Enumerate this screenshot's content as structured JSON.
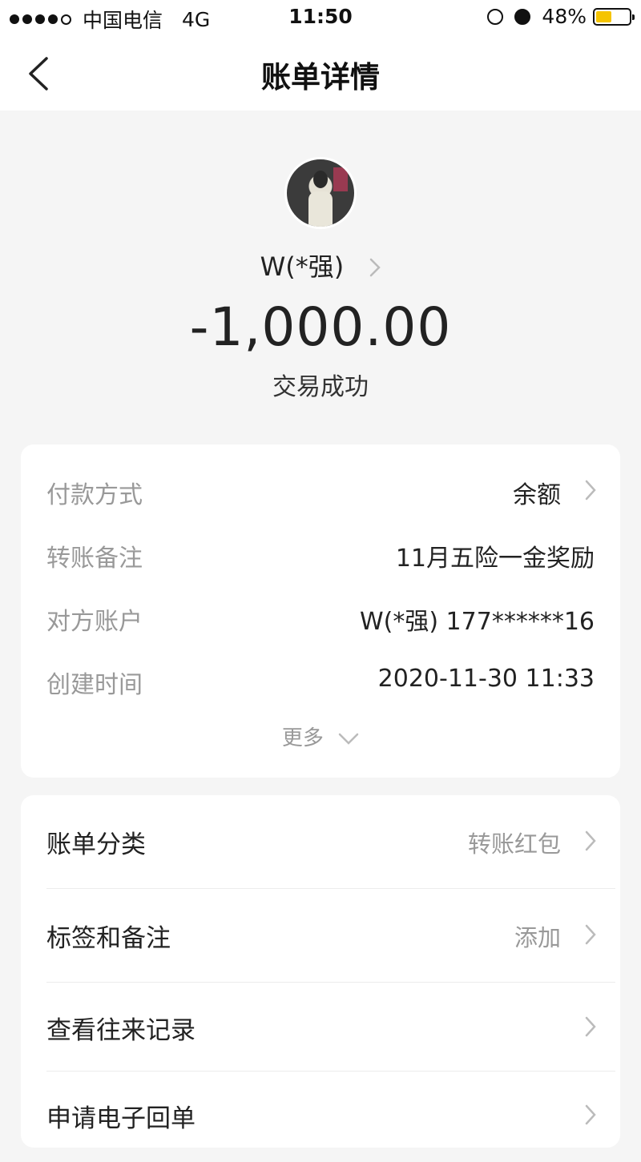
{
  "status_bar": {
    "carrier": "中国电信",
    "network": "4G",
    "time": "11:50",
    "battery_percent": "48%",
    "battery_level": 0.48,
    "battery_color": "#f5c400"
  },
  "nav": {
    "title": "账单详情",
    "back_icon": "chevron-left-icon"
  },
  "payee": {
    "name": "W(*强)",
    "amount": "-1,000.00",
    "status": "交易成功"
  },
  "details": {
    "rows": [
      {
        "label": "付款方式",
        "value": "余额",
        "has_chevron": true
      },
      {
        "label": "转账备注",
        "value": "11月五险一金奖励",
        "has_chevron": false
      },
      {
        "label": "对方账户",
        "value": "W(*强) 177******16",
        "has_chevron": false
      },
      {
        "label": "创建时间",
        "value": "2020-11-30 11:33",
        "has_chevron": false
      }
    ],
    "more_label": "更多"
  },
  "menu": {
    "items": [
      {
        "label": "账单分类",
        "value": "转账红包"
      },
      {
        "label": "标签和备注",
        "value": "添加"
      },
      {
        "label": "查看往来记录",
        "value": ""
      },
      {
        "label": "申请电子回单",
        "value": ""
      }
    ]
  }
}
